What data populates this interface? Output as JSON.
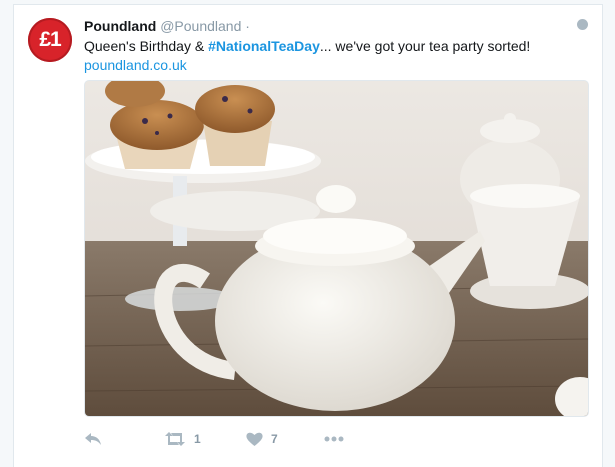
{
  "tweet": {
    "display_name": "Poundland",
    "username": "@Poundland",
    "separator": "·",
    "avatar_text": "£1",
    "text_part1": "Queen's Birthday & ",
    "hashtag": "#NationalTeaDay",
    "text_part2": "... we've got your tea party sorted!",
    "link": "poundland.co.uk",
    "image_desc_icon": "globe-icon",
    "actions": {
      "reply_icon": "reply-icon",
      "retweet_icon": "retweet-icon",
      "retweet_count": "1",
      "like_icon": "heart-icon",
      "like_count": "7",
      "more_icon": "more-icon"
    },
    "colors": {
      "link": "#1b95e0",
      "avatar_red": "#d8232a",
      "muted": "#8899a6"
    }
  }
}
